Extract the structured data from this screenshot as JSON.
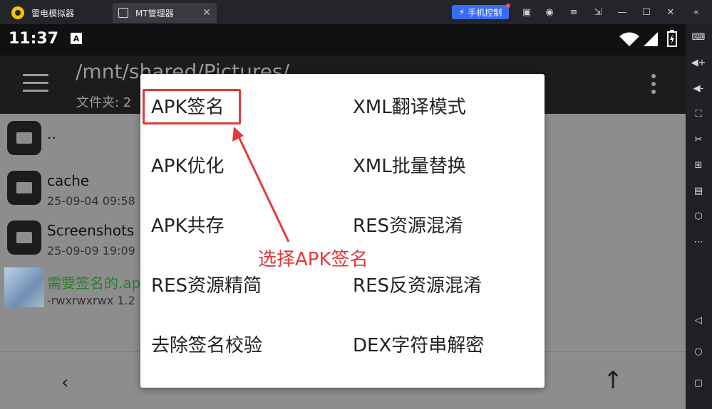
{
  "emulator": {
    "tabs": [
      {
        "label": "雷电模拟器"
      },
      {
        "label": "MT管理器"
      }
    ],
    "mobile_control_label": "手机控制"
  },
  "status": {
    "time": "11:37",
    "badge": "A"
  },
  "appbar": {
    "path": "/mnt/shared/Pictures/",
    "folders": "文件夹: 2"
  },
  "files": [
    {
      "name": "..",
      "meta": ""
    },
    {
      "name": "cache",
      "meta": "25-09-04 09:58"
    },
    {
      "name": "Screenshots",
      "meta": "25-09-09 19:09"
    },
    {
      "name": "需要签名的.apk",
      "meta": "-rwxrwxrwx 1.2"
    }
  ],
  "dialog": {
    "left_options": [
      "APK签名",
      "APK优化",
      "APK共存",
      "RES资源精简",
      "去除签名校验"
    ],
    "right_options": [
      "XML翻译模式",
      "XML批量替换",
      "RES资源混淆",
      "RES反资源混淆",
      "DEX字符串解密"
    ]
  },
  "annotation": {
    "text": "选择APK签名",
    "color": "#e03b3b"
  },
  "colors": {
    "emulator_bg": "#24252a",
    "accent_blue": "#3b6cf6",
    "apk_green": "#2e7d32"
  }
}
